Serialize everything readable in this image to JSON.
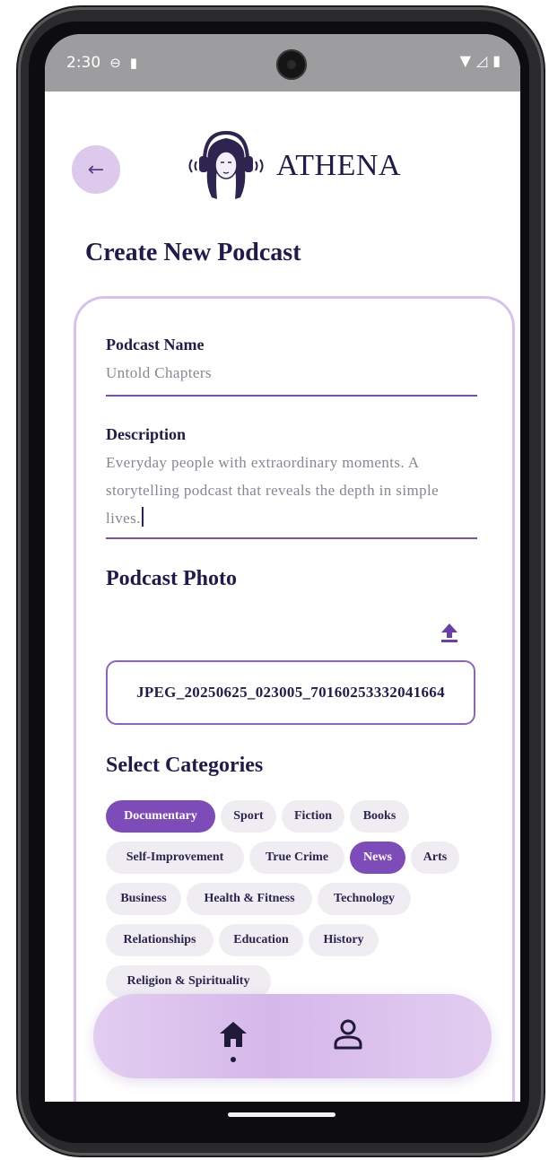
{
  "status_bar": {
    "time": "2:30"
  },
  "app": {
    "brand_name": "ATHENA"
  },
  "page": {
    "title": "Create New Podcast"
  },
  "form": {
    "name_label": "Podcast Name",
    "name_value": "Untold Chapters",
    "description_label": "Description",
    "description_value": "Everyday people with extraordinary moments. A storytelling podcast that reveals the depth in simple lives.",
    "photo_title": "Podcast Photo",
    "photo_filename": "JPEG_20250625_023005_70160253332041664",
    "categories_title": "Select Categories"
  },
  "categories": [
    {
      "label": "Documentary",
      "selected": true
    },
    {
      "label": "Sport",
      "selected": false
    },
    {
      "label": "Fiction",
      "selected": false
    },
    {
      "label": "Books",
      "selected": false
    },
    {
      "label": "Self-Improvement",
      "selected": false
    },
    {
      "label": "True Crime",
      "selected": false
    },
    {
      "label": "News",
      "selected": true
    },
    {
      "label": "Arts",
      "selected": false
    },
    {
      "label": "Business",
      "selected": false
    },
    {
      "label": "Health & Fitness",
      "selected": false
    },
    {
      "label": "Technology",
      "selected": false
    },
    {
      "label": "Relationships",
      "selected": false
    },
    {
      "label": "Education",
      "selected": false
    },
    {
      "label": "History",
      "selected": false
    },
    {
      "label": "Religion & Spirituality",
      "selected": false
    }
  ],
  "bottom_nav": {
    "items": [
      {
        "icon": "home-icon",
        "active": true
      },
      {
        "icon": "profile-icon",
        "active": false
      }
    ]
  },
  "colors": {
    "accent": "#7d4cb8",
    "accent_light": "#dcc9ec",
    "title_text": "#211a4d",
    "chip_bg": "#efedf2"
  }
}
